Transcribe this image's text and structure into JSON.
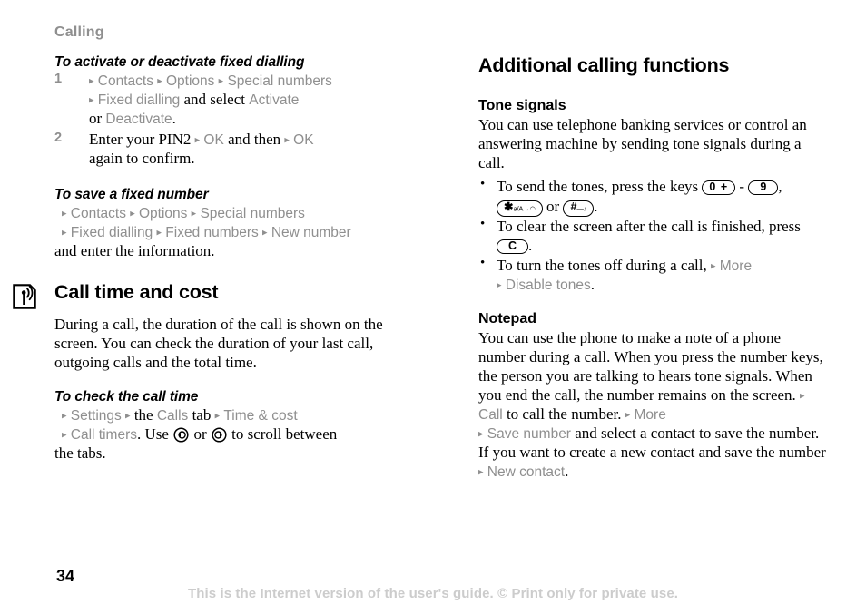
{
  "header": {
    "running_head": "Calling"
  },
  "colors": {
    "ui_term_grey": "#8f8f8f",
    "footer_grey": "#cccccc",
    "text_black": "#000000",
    "page_background": "#ffffff"
  },
  "left_column": {
    "task1": {
      "title": "To activate or deactivate fixed dialling",
      "steps": [
        {
          "number": "1",
          "parts": [
            {
              "type": "arrow"
            },
            {
              "type": "ui",
              "text": "Contacts"
            },
            {
              "type": "arrow"
            },
            {
              "type": "ui",
              "text": "Options"
            },
            {
              "type": "arrow"
            },
            {
              "type": "ui",
              "text": "Special numbers"
            },
            {
              "type": "break"
            },
            {
              "type": "arrow"
            },
            {
              "type": "ui",
              "text": "Fixed dialling"
            },
            {
              "type": "text",
              "text": " and select "
            },
            {
              "type": "ui",
              "text": "Activate"
            },
            {
              "type": "break"
            },
            {
              "type": "text",
              "text": "or "
            },
            {
              "type": "ui",
              "text": "Deactivate"
            },
            {
              "type": "text",
              "text": "."
            }
          ]
        },
        {
          "number": "2",
          "parts": [
            {
              "type": "text",
              "text": "Enter your PIN2 "
            },
            {
              "type": "arrow"
            },
            {
              "type": "ui",
              "text": "OK"
            },
            {
              "type": "text",
              "text": " and then "
            },
            {
              "type": "arrow"
            },
            {
              "type": "ui",
              "text": "OK"
            },
            {
              "type": "break"
            },
            {
              "type": "text",
              "text": "again to confirm."
            }
          ]
        }
      ]
    },
    "task2": {
      "title": "To save a fixed number",
      "line1": {
        "arrow1": "▸",
        "term1": "Contacts",
        "arrow2": "▸",
        "term2": "Options",
        "arrow3": "▸",
        "term3": "Special numbers"
      },
      "line2": {
        "arrow1": "▸",
        "term1": "Fixed dialling",
        "arrow2": "▸",
        "term2": "Fixed numbers",
        "arrow3": "▸",
        "term3": "New number"
      },
      "line3": "and enter the information."
    },
    "feature": {
      "icon": "antenna-signal-icon",
      "title": "Call time and cost",
      "body": "During a call, the duration of the call is shown on the screen. You can check the duration of your last call, outgoing calls and the total time."
    },
    "task3": {
      "title": "To check the call time",
      "line1": {
        "arrow1": "▸",
        "term1": "Settings",
        "arrow2": "▸",
        "mid": " the ",
        "term2": "Calls",
        "mid2": " tab ",
        "arrow3": "▸",
        "term3": "Time & cost"
      },
      "line2": {
        "arrow1": "▸",
        "term1": "Call timers",
        "after": ". Use ",
        "key_left": "nav-left-key",
        "or": " or ",
        "key_right": "nav-right-key",
        "tail": " to scroll between"
      },
      "line3": "the tabs."
    }
  },
  "right_column": {
    "section_title": "Additional calling functions",
    "tone_signals": {
      "title": "Tone signals",
      "body": "You can use telephone banking services or control an answering machine by sending tone signals during a call.",
      "bullets": [
        {
          "lead": "To send the tones, press the keys ",
          "key_0": {
            "main": "0",
            "sub": "+"
          },
          "dash": " - ",
          "key_9": {
            "main": "9",
            "sub": ""
          },
          "comma": ",",
          "key_star": {
            "main": "✱",
            "sub": "a/A→◠"
          },
          "or": " or ",
          "key_hash": {
            "main": "#",
            "sub": "—♪"
          },
          "period": "."
        },
        {
          "lead": "To clear the screen after the call is finished, press ",
          "key_c": {
            "main": "C",
            "sub": ""
          },
          "period": "."
        },
        {
          "lead": "To turn the tones off during a call, ",
          "arrow1": "▸",
          "term1": "More",
          "arrow2": "▸",
          "term2": "Disable tones",
          "period": "."
        }
      ]
    },
    "notepad": {
      "title": "Notepad",
      "parts": [
        {
          "type": "text",
          "text": "You can use the phone to make a note of a phone number during a call. When you press the number keys, the person you are talking to hears tone signals. When you end the call, the number remains on the screen. "
        },
        {
          "type": "arrow"
        },
        {
          "type": "ui",
          "text": "Call"
        },
        {
          "type": "text",
          "text": " to call the number. "
        },
        {
          "type": "arrow"
        },
        {
          "type": "ui",
          "text": "More"
        },
        {
          "type": "break"
        },
        {
          "type": "arrow"
        },
        {
          "type": "ui",
          "text": "Save number"
        },
        {
          "type": "text",
          "text": " and select a contact to save the number. If you want to create a new contact and save the number "
        },
        {
          "type": "arrow"
        },
        {
          "type": "ui",
          "text": "New contact"
        },
        {
          "type": "text",
          "text": "."
        }
      ]
    }
  },
  "footer": {
    "page_number": "34",
    "note": "This is the Internet version of the user's guide. © Print only for private use."
  }
}
